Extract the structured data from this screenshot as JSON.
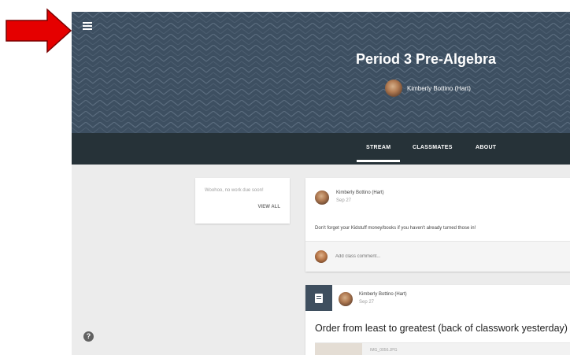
{
  "colors": {
    "banner": "#3d4f61",
    "tabbar": "#263238",
    "background": "#ececec",
    "arrow": "#ff0000"
  },
  "annotation": {
    "icon": "red-arrow"
  },
  "header": {
    "menu_icon": "hamburger-menu-icon",
    "class_title": "Period 3 Pre-Algebra",
    "teacher_name": "Kimberly Bottino (Hart)"
  },
  "tabs": [
    {
      "label": "STREAM",
      "active": true
    },
    {
      "label": "CLASSMATES",
      "active": false
    },
    {
      "label": "ABOUT",
      "active": false
    }
  ],
  "upcoming": {
    "message": "Woohoo, no work due soon!",
    "view_all": "VIEW ALL"
  },
  "posts": [
    {
      "author": "Kimberly Bottino (Hart)",
      "date": "Sep 27",
      "text": "Don't forget your Kidstuff money/books if you haven't already turned those in!",
      "comment_placeholder": "Add class comment..."
    },
    {
      "type_icon": "assignment-icon",
      "author": "Kimberly Bottino (Hart)",
      "date": "Sep 27",
      "title": "Order from least to greatest (back of classwork yesterday)",
      "attachment_name": "IMG_0056.JPG"
    }
  ],
  "help_icon": "help-icon"
}
